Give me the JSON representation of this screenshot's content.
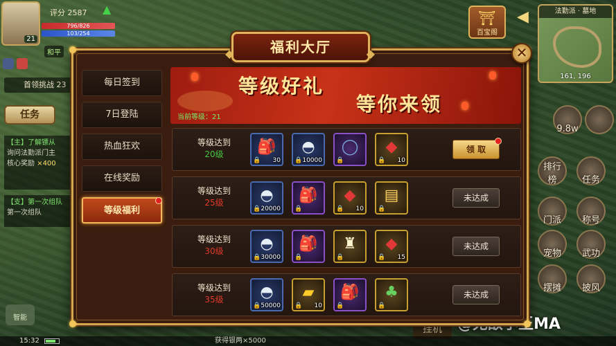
{
  "hud": {
    "score_text": "评分 2587",
    "hp_text": "796/826",
    "mp_text": "103/254",
    "avatar_level": "21",
    "peace_tag": "和平",
    "challenge_text": "首领挑战 23",
    "task_label": "任务",
    "quest1": {
      "title": "【主】了解镖从",
      "line1": "询问法勤派门主",
      "line2_label": "核心奖励",
      "line2_value": "×400"
    },
    "quest2": {
      "title": "【支】第一次组队",
      "line1": "第一次组队"
    },
    "left_mini_label": "智能",
    "time": "15:32",
    "chat_snippet": "获得银两×5000",
    "hang_label": "挂机",
    "treasure_label": "百宝阁",
    "minimap_title": "法勤派 · 墓地",
    "minimap_coord": "161, 196",
    "right_buttons": [
      {
        "label": "",
        "top": 0
      },
      {
        "label": "9.8w"
      },
      {
        "label": "排行榜"
      },
      {
        "label": "任务"
      },
      {
        "label": "门派"
      },
      {
        "label": "称号"
      },
      {
        "label": "宠物"
      },
      {
        "label": "武功"
      },
      {
        "label": "摆摊"
      },
      {
        "label": "披风"
      }
    ],
    "watermark": "@无敌小王MA"
  },
  "dialog": {
    "title": "福利大厅",
    "close_symbol": "✕",
    "sidebar": [
      {
        "label": "每日签到",
        "active": false,
        "badge": false
      },
      {
        "label": "7日登陆",
        "active": false,
        "badge": false
      },
      {
        "label": "热血狂欢",
        "active": false,
        "badge": false
      },
      {
        "label": "在线奖励",
        "active": false,
        "badge": false
      },
      {
        "label": "等级福利",
        "active": true,
        "badge": true
      }
    ],
    "banner": {
      "title1": "等级好礼",
      "title2": "等你来领",
      "current_level": "当前等级：21"
    },
    "rows": [
      {
        "req_label": "等级达到",
        "req_level": "20级",
        "achieved": true,
        "button": "领 取",
        "items": [
          {
            "icon": "red-pouch-icon",
            "glyph": "🎒",
            "count": "30",
            "quality": "blue",
            "color": "g-bag"
          },
          {
            "icon": "silver-ingot-icon",
            "glyph": "◓",
            "count": "10000",
            "quality": "blue",
            "color": "g-silver"
          },
          {
            "icon": "jade-ring-icon",
            "glyph": "◯",
            "count": "",
            "quality": "purple",
            "color": "g-ring"
          },
          {
            "icon": "red-gem-icon",
            "glyph": "◆",
            "count": "10",
            "quality": "yellow",
            "color": "g-red"
          }
        ]
      },
      {
        "req_label": "等级达到",
        "req_level": "25级",
        "achieved": false,
        "button": "未达成",
        "items": [
          {
            "icon": "silver-ingot-icon",
            "glyph": "◓",
            "count": "20000",
            "quality": "blue",
            "color": "g-silver"
          },
          {
            "icon": "red-pouch-set-icon",
            "glyph": "🎒",
            "count": "",
            "quality": "purple",
            "color": "g-bag"
          },
          {
            "icon": "red-gem-icon",
            "glyph": "◆",
            "count": "10",
            "quality": "yellow",
            "color": "g-red"
          },
          {
            "icon": "skill-book-icon",
            "glyph": "▤",
            "count": "",
            "quality": "yellow",
            "color": "g-book"
          }
        ]
      },
      {
        "req_label": "等级达到",
        "req_level": "30级",
        "achieved": false,
        "button": "未达成",
        "items": [
          {
            "icon": "silver-ingot-icon",
            "glyph": "◓",
            "count": "30000",
            "quality": "blue",
            "color": "g-silver"
          },
          {
            "icon": "red-pouch-set-icon",
            "glyph": "🎒",
            "count": "",
            "quality": "purple",
            "color": "g-bag"
          },
          {
            "icon": "armor-icon",
            "glyph": "♜",
            "count": "",
            "quality": "yellow",
            "color": "g-armor"
          },
          {
            "icon": "red-gem-icon",
            "glyph": "◆",
            "count": "15",
            "quality": "yellow",
            "color": "g-red"
          }
        ]
      },
      {
        "req_label": "等级达到",
        "req_level": "35级",
        "achieved": false,
        "button": "未达成",
        "items": [
          {
            "icon": "silver-ingot-icon",
            "glyph": "◓",
            "count": "50000",
            "quality": "blue",
            "color": "g-silver"
          },
          {
            "icon": "gold-bar-icon",
            "glyph": "▰",
            "count": "10",
            "quality": "yellow",
            "color": "g-gold"
          },
          {
            "icon": "red-pouch-set-icon",
            "glyph": "🎒",
            "count": "",
            "quality": "purple",
            "color": "g-bag"
          },
          {
            "icon": "jade-pendant-icon",
            "glyph": "♣",
            "count": "",
            "quality": "yellow",
            "color": "g-jade"
          }
        ]
      }
    ]
  }
}
